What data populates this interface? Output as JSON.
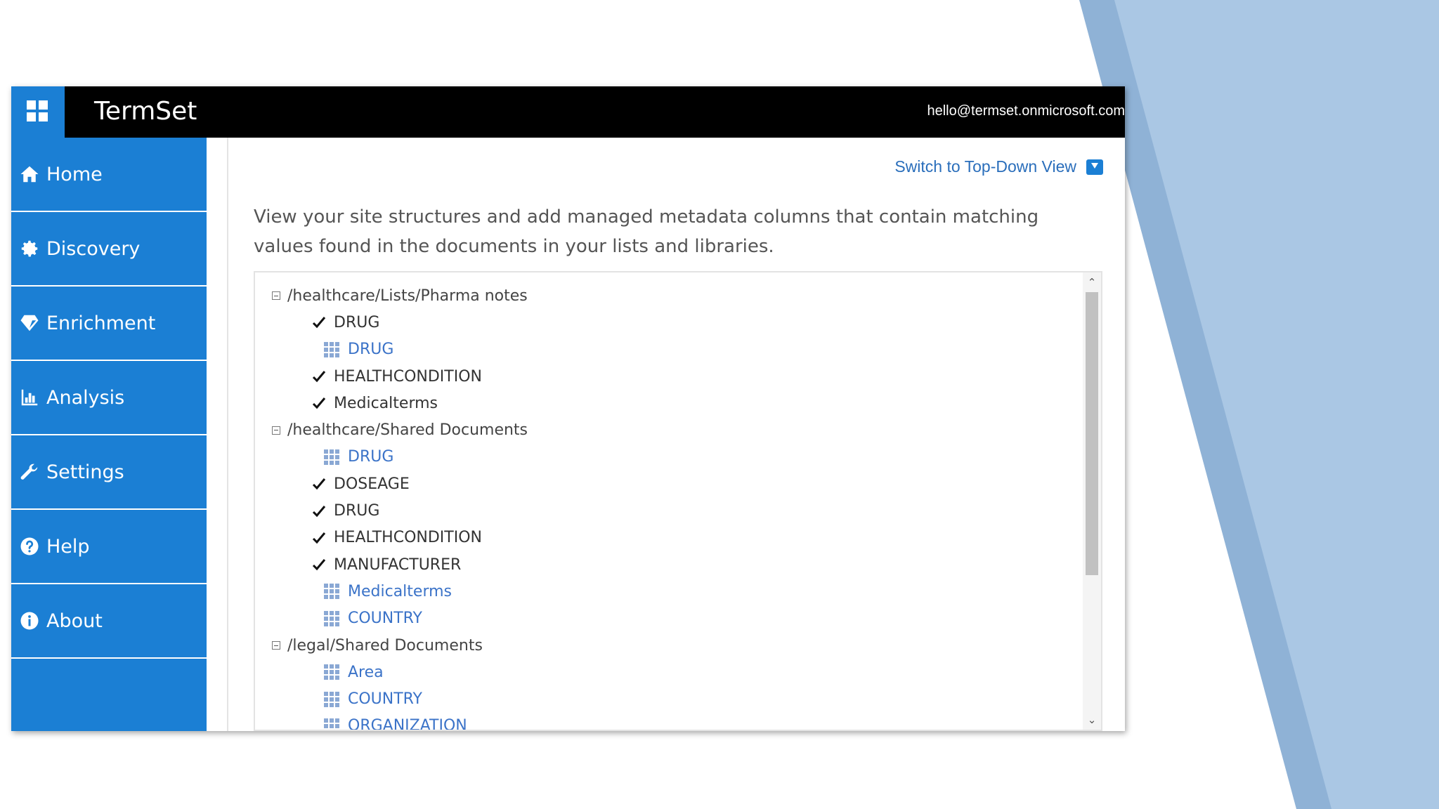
{
  "app": {
    "title": "TermSet",
    "user_email": "hello@termset.onmicrosoft.com"
  },
  "colors": {
    "brand_blue": "#1b7fd4",
    "topbar": "#000000",
    "link_blue": "#3b73c8",
    "deco_light": "#aac7e4",
    "deco_mid": "#8fb2d6"
  },
  "nav": {
    "items": [
      {
        "label": "Home",
        "icon": "home-icon"
      },
      {
        "label": "Discovery",
        "icon": "gear-icon"
      },
      {
        "label": "Enrichment",
        "icon": "diamond-icon"
      },
      {
        "label": "Analysis",
        "icon": "bar-chart-icon"
      },
      {
        "label": "Settings",
        "icon": "wrench-icon"
      },
      {
        "label": "Help",
        "icon": "question-circle-icon"
      },
      {
        "label": "About",
        "icon": "info-circle-icon"
      }
    ]
  },
  "content": {
    "switch_link": "Switch to Top-Down View",
    "intro": "View your site structures and add managed metadata columns that contain matching values found in the documents in your lists and libraries."
  },
  "tree": {
    "rows": [
      {
        "type": "folder",
        "label": "/healthcare/Lists/Pharma notes"
      },
      {
        "type": "check",
        "label": "DRUG"
      },
      {
        "type": "term",
        "label": "DRUG"
      },
      {
        "type": "check",
        "label": "HEALTHCONDITION"
      },
      {
        "type": "check",
        "label": "Medicalterms"
      },
      {
        "type": "folder",
        "label": "/healthcare/Shared Documents"
      },
      {
        "type": "term",
        "label": "DRUG"
      },
      {
        "type": "check",
        "label": "DOSEAGE"
      },
      {
        "type": "check",
        "label": "DRUG"
      },
      {
        "type": "check",
        "label": "HEALTHCONDITION"
      },
      {
        "type": "check",
        "label": "MANUFACTURER"
      },
      {
        "type": "term",
        "label": "Medicalterms"
      },
      {
        "type": "term",
        "label": "COUNTRY"
      },
      {
        "type": "folder",
        "label": "/legal/Shared Documents"
      },
      {
        "type": "term",
        "label": "Area"
      },
      {
        "type": "term",
        "label": "COUNTRY"
      },
      {
        "type": "term",
        "label": "ORGANIZATION"
      }
    ]
  }
}
